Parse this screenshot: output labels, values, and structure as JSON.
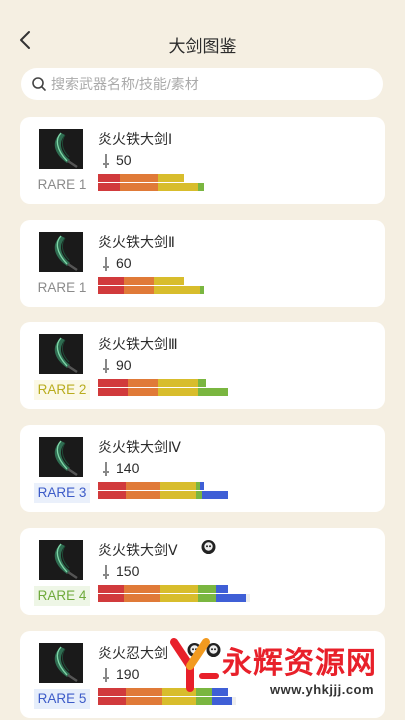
{
  "header": {
    "title": "大剑图鉴"
  },
  "search": {
    "placeholder": "搜索武器名称/技能/素材",
    "value": ""
  },
  "colors": {
    "red": "#d13a3c",
    "orange": "#e07a38",
    "yellow": "#d8bd2c",
    "green": "#7ab640",
    "blue": "#3f5fd6",
    "white": "#eeeeee"
  },
  "weapons": [
    {
      "name": "炎火铁大剑Ⅰ",
      "attack": "50",
      "rare": "RARE 1",
      "rare_color": "#8b8b8b",
      "rare_bg": "#ffffff",
      "badges": []
    },
    {
      "name": "炎火铁大剑Ⅱ",
      "attack": "60",
      "rare": "RARE 1",
      "rare_color": "#8b8b8b",
      "rare_bg": "#ffffff",
      "badges": []
    },
    {
      "name": "炎火铁大剑Ⅲ",
      "attack": "90",
      "rare": "RARE 2",
      "rare_color": "#b9ac1e",
      "rare_bg": "#fbf8e6",
      "badges": []
    },
    {
      "name": "炎火铁大剑Ⅳ",
      "attack": "140",
      "rare": "RARE 3",
      "rare_color": "#3c5bc8",
      "rare_bg": "#eaf0fb",
      "badges": []
    },
    {
      "name": "炎火铁大剑Ⅴ",
      "attack": "150",
      "rare": "RARE 4",
      "rare_color": "#6faa3c",
      "rare_bg": "#eef6e6",
      "badges": [
        "skull-badge-icon"
      ]
    },
    {
      "name": "炎火忍大剑",
      "attack": "190",
      "rare": "RARE 5",
      "rare_color": "#3c5bc8",
      "rare_bg": "#e6eefb",
      "badges": [
        "skull-badge-icon",
        "skull-badge-icon"
      ]
    }
  ],
  "watermark": {
    "text": "永辉资源网",
    "url": "www.yhkjjj.com"
  }
}
